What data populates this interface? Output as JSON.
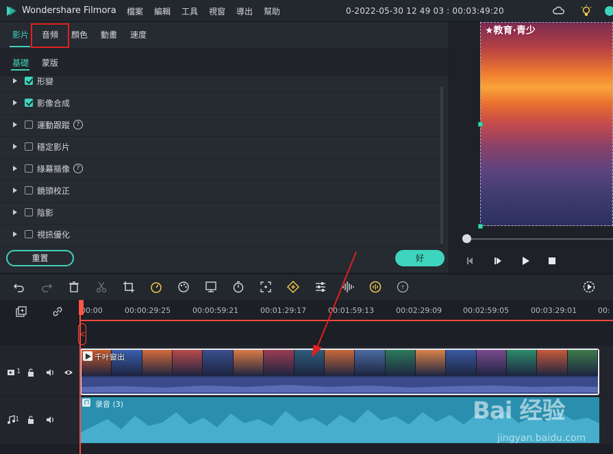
{
  "app": {
    "name": "Wondershare Filmora",
    "project_title": "0-2022-05-30 12 49 03 : 00:03:49:20",
    "menu": [
      "檔案",
      "編輯",
      "工具",
      "視窗",
      "導出",
      "幫助"
    ]
  },
  "tabs": [
    {
      "label": "影片",
      "active": true
    },
    {
      "label": "音頻",
      "active": false
    },
    {
      "label": "顏色",
      "active": false
    },
    {
      "label": "動畫",
      "active": false
    },
    {
      "label": "速度",
      "active": false
    }
  ],
  "subtabs": [
    {
      "label": "基礎",
      "active": true
    },
    {
      "label": "蒙版",
      "active": false
    }
  ],
  "properties": [
    {
      "label": "形變",
      "checked": true,
      "help": false
    },
    {
      "label": "影像合成",
      "checked": true,
      "help": false
    },
    {
      "label": "運動跟蹤",
      "checked": false,
      "help": true
    },
    {
      "label": "穩定影片",
      "checked": false,
      "help": false
    },
    {
      "label": "綠幕摳像",
      "checked": false,
      "help": true
    },
    {
      "label": "鏡頭校正",
      "checked": false,
      "help": false
    },
    {
      "label": "陰影",
      "checked": false,
      "help": false
    },
    {
      "label": "視訊優化",
      "checked": false,
      "help": false
    }
  ],
  "buttons": {
    "reset": "重置",
    "ok": "好"
  },
  "preview": {
    "overlay_text": "★教育·青少",
    "progress": 0.0
  },
  "ruler": [
    "00:00",
    "00:00:29:25",
    "00:00:59:21",
    "00:01:29:17",
    "00:01:59:13",
    "00:02:29:09",
    "00:02:59:05",
    "00:03:29:01",
    "00:"
  ],
  "tracks": {
    "video1": {
      "label": "1",
      "clip_title": "千叶窗出"
    },
    "audio1": {
      "label": "1",
      "clip_title": "录音 (3)"
    }
  },
  "watermark": {
    "brand": "Bai 经验",
    "url": "jingyan.baidu.com"
  },
  "colors": {
    "accent": "#3fd4bd",
    "playhead": "#ff4a3d",
    "highlight": "#e02020"
  }
}
